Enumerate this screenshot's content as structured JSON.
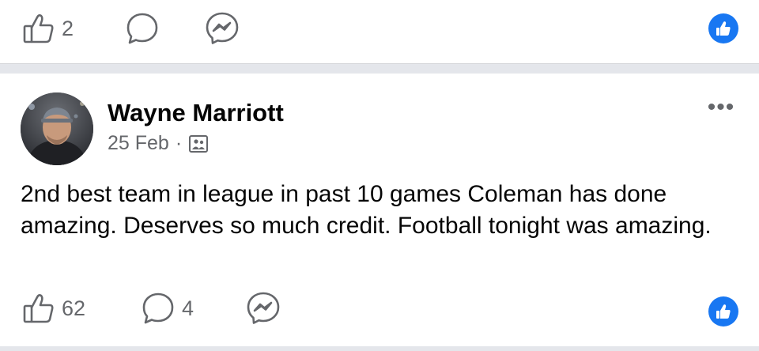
{
  "top_action_bar": {
    "like_count": "2",
    "comment_count": "",
    "icons": {
      "like": "thumbs-up-outline",
      "comment": "speech-bubble",
      "share": "messenger",
      "reaction": "like-reaction"
    }
  },
  "post": {
    "author": "Wayne Marriott",
    "date": "25 Feb",
    "separator": "·",
    "privacy_icon": "friends-audience",
    "more_label": "•••",
    "text": "2nd best team in league in past 10 games Coleman has done amazing. Deserves so much credit. Football tonight was amazing."
  },
  "bottom_action_bar": {
    "like_count": "62",
    "comment_count": "4",
    "icons": {
      "like": "thumbs-up-outline",
      "comment": "speech-bubble",
      "share": "messenger",
      "reaction": "like-reaction"
    }
  },
  "colors": {
    "text_primary": "#050505",
    "text_secondary": "#65676b",
    "divider": "#e4e6eb",
    "reaction_blue": "#1877f2"
  }
}
